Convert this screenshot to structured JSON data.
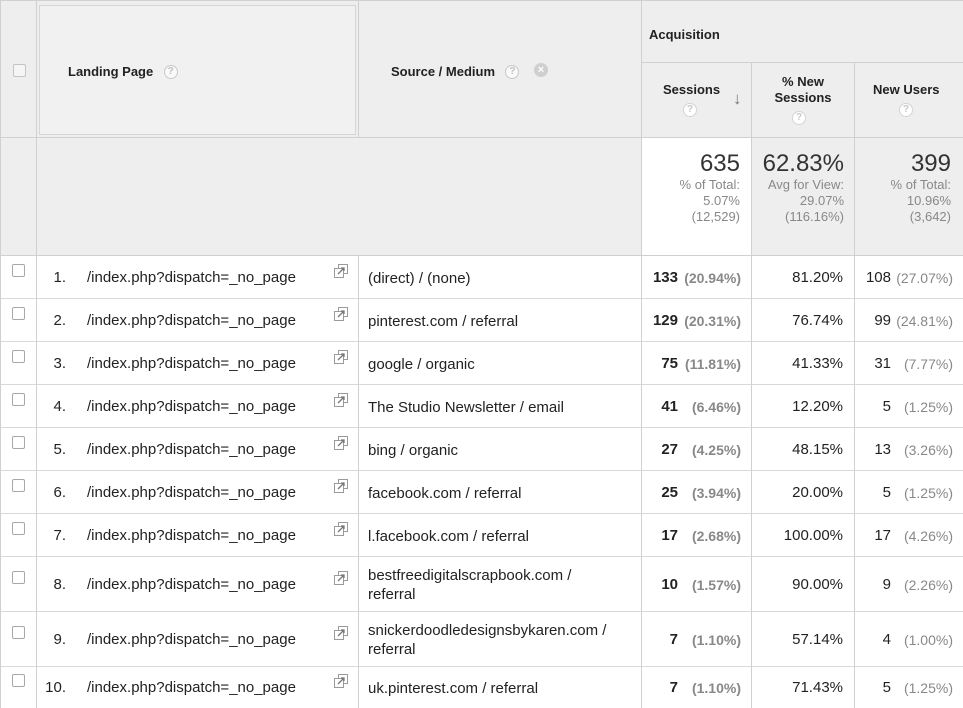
{
  "header": {
    "landing_page": "Landing Page",
    "source_medium": "Source / Medium",
    "acquisition": "Acquisition",
    "sessions": "Sessions",
    "pct_new_sessions_line1": "% New",
    "pct_new_sessions_line2": "Sessions",
    "new_users": "New Users",
    "help_glyph": "?",
    "close_glyph": "×",
    "sort_glyph": "↓"
  },
  "totals": {
    "sessions": "635",
    "sessions_sub1": "% of Total:",
    "sessions_sub2": "5.07%",
    "sessions_sub3": "(12,529)",
    "pct_new": "62.83%",
    "pct_new_sub1": "Avg for View:",
    "pct_new_sub2": "29.07%",
    "pct_new_sub3": "(116.16%)",
    "new_users": "399",
    "new_users_sub1": "% of Total:",
    "new_users_sub2": "10.96%",
    "new_users_sub3": "(3,642)"
  },
  "rows": [
    {
      "index": "1.",
      "landing": "/index.php?dispatch=_no_page",
      "source1": "(direct) / (none)",
      "source2": "",
      "sessions": "133",
      "sessions_pct": "(20.94%)",
      "pct_new": "81.20%",
      "new_users": "108",
      "new_users_pct": "(27.07%)"
    },
    {
      "index": "2.",
      "landing": "/index.php?dispatch=_no_page",
      "source1": "pinterest.com / referral",
      "source2": "",
      "sessions": "129",
      "sessions_pct": "(20.31%)",
      "pct_new": "76.74%",
      "new_users": "99",
      "new_users_pct": "(24.81%)"
    },
    {
      "index": "3.",
      "landing": "/index.php?dispatch=_no_page",
      "source1": "google / organic",
      "source2": "",
      "sessions": "75",
      "sessions_pct": "(11.81%)",
      "pct_new": "41.33%",
      "new_users": "31",
      "new_users_pct": "(7.77%)"
    },
    {
      "index": "4.",
      "landing": "/index.php?dispatch=_no_page",
      "source1": "The Studio Newsletter / email",
      "source2": "",
      "sessions": "41",
      "sessions_pct": "(6.46%)",
      "pct_new": "12.20%",
      "new_users": "5",
      "new_users_pct": "(1.25%)"
    },
    {
      "index": "5.",
      "landing": "/index.php?dispatch=_no_page",
      "source1": "bing / organic",
      "source2": "",
      "sessions": "27",
      "sessions_pct": "(4.25%)",
      "pct_new": "48.15%",
      "new_users": "13",
      "new_users_pct": "(3.26%)"
    },
    {
      "index": "6.",
      "landing": "/index.php?dispatch=_no_page",
      "source1": "facebook.com / referral",
      "source2": "",
      "sessions": "25",
      "sessions_pct": "(3.94%)",
      "pct_new": "20.00%",
      "new_users": "5",
      "new_users_pct": "(1.25%)"
    },
    {
      "index": "7.",
      "landing": "/index.php?dispatch=_no_page",
      "source1": "l.facebook.com / referral",
      "source2": "",
      "sessions": "17",
      "sessions_pct": "(2.68%)",
      "pct_new": "100.00%",
      "new_users": "17",
      "new_users_pct": "(4.26%)"
    },
    {
      "index": "8.",
      "landing": "/index.php?dispatch=_no_page",
      "source1": "bestfreedigitalscrapbook.com /",
      "source2": "referral",
      "sessions": "10",
      "sessions_pct": "(1.57%)",
      "pct_new": "90.00%",
      "new_users": "9",
      "new_users_pct": "(2.26%)"
    },
    {
      "index": "9.",
      "landing": "/index.php?dispatch=_no_page",
      "source1": "snickerdoodledesignsbykaren.com /",
      "source2": "referral",
      "sessions": "7",
      "sessions_pct": "(1.10%)",
      "pct_new": "57.14%",
      "new_users": "4",
      "new_users_pct": "(1.00%)"
    },
    {
      "index": "10.",
      "landing": "/index.php?dispatch=_no_page",
      "source1": "uk.pinterest.com / referral",
      "source2": "",
      "sessions": "7",
      "sessions_pct": "(1.10%)",
      "pct_new": "71.43%",
      "new_users": "5",
      "new_users_pct": "(1.25%)"
    }
  ]
}
